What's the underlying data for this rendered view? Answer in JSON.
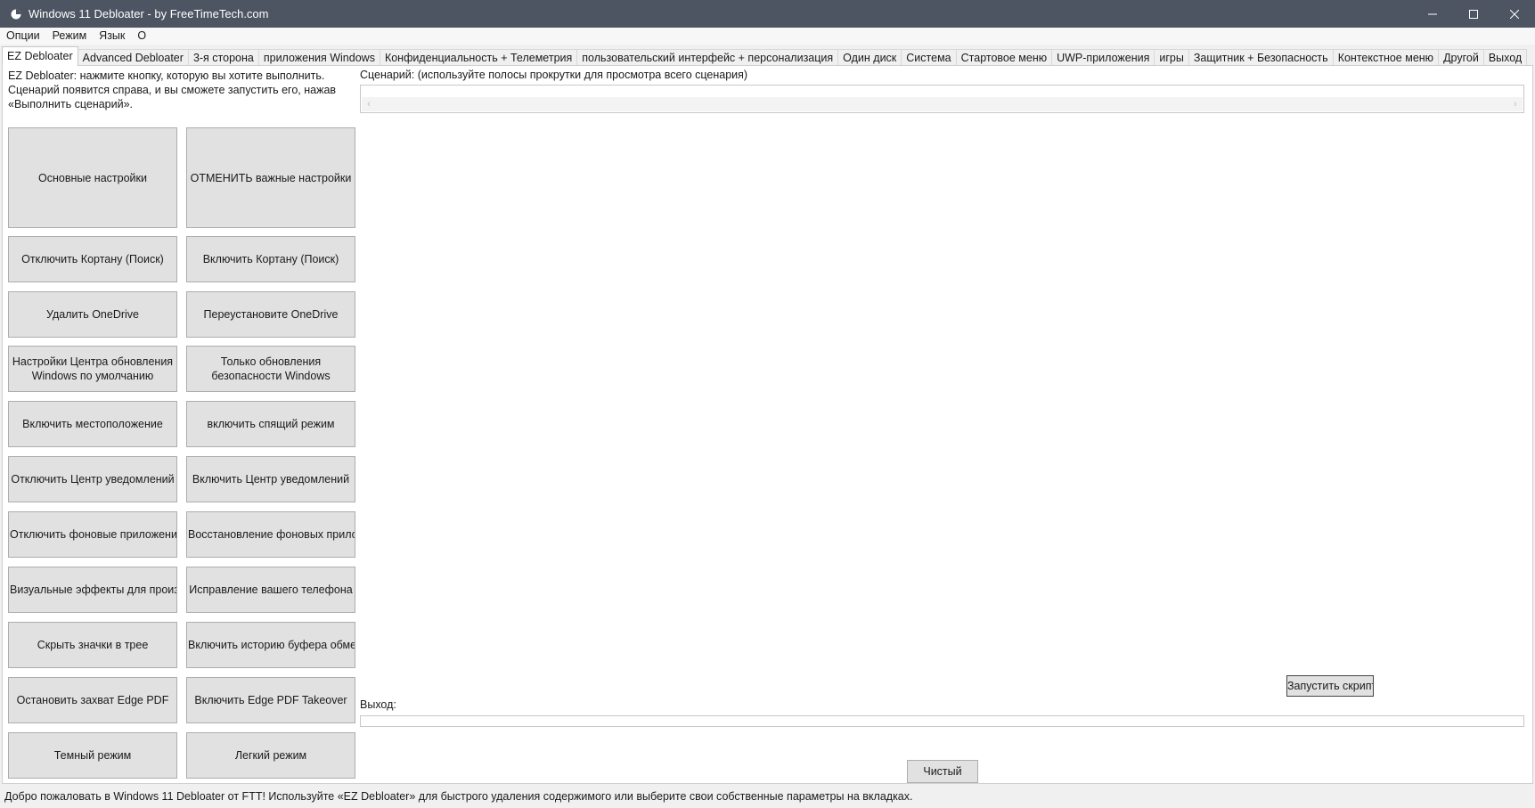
{
  "window": {
    "title": "Windows 11 Debloater - by FreeTimeTech.com"
  },
  "menu": [
    "Опции",
    "Режим",
    "Язык",
    "О"
  ],
  "tabs": [
    {
      "label": "EZ Debloater",
      "active": true
    },
    {
      "label": "Advanced Debloater"
    },
    {
      "label": "3-я сторона"
    },
    {
      "label": "приложения Windows"
    },
    {
      "label": "Конфиденциальность + Телеметрия"
    },
    {
      "label": "пользовательский интерфейс + персонализация"
    },
    {
      "label": "Один диск"
    },
    {
      "label": "Система"
    },
    {
      "label": "Стартовое меню"
    },
    {
      "label": "UWP-приложения"
    },
    {
      "label": "игры"
    },
    {
      "label": "Защитник + Безопасность"
    },
    {
      "label": "Контекстное меню"
    },
    {
      "label": "Другой"
    },
    {
      "label": "Выход"
    }
  ],
  "ez": {
    "intro": "EZ Debloater: нажмите кнопку, которую вы хотите выполнить.\nСценарий появится справа, и вы сможете запустить его, нажав\n«Выполнить сценарий».",
    "buttons": [
      [
        "Основные настройки",
        "ОТМЕНИТЬ важные настройки"
      ],
      [
        "Отключить Кортану (Поиск)",
        "Включить Кортану (Поиск)"
      ],
      [
        "Удалить OneDrive",
        "Переустановите OneDrive"
      ],
      [
        "Настройки Центра обновления\nWindows по умолчанию",
        "Только обновления\nбезопасности Windows"
      ],
      [
        "Включить местоположение",
        "включить спящий режим"
      ],
      [
        "Отключить Центр уведомлений",
        "Включить Центр уведомлений"
      ],
      [
        "Отключить фоновые приложения",
        "Восстановление фоновых прилож"
      ],
      [
        "Визуальные эффекты для произвс",
        "Исправление вашего телефона"
      ],
      [
        "Скрыть значки в трее",
        "Включить историю буфера обмен"
      ],
      [
        "Остановить захват Edge PDF",
        "Включить Edge PDF Takeover"
      ],
      [
        "Темный режим",
        "Легкий режим"
      ]
    ]
  },
  "script": {
    "label": "Сценарий: (используйте полосы прокрутки для просмотра всего сценария)",
    "run_label": "Запустить скрипт"
  },
  "output": {
    "label": "Выход:",
    "clear_label": "Чистый"
  },
  "status": "Добро пожаловать в Windows 11 Debloater от FTT! Используйте «EZ Debloater» для быстрого удаления содержимого или выберите свои собственные параметры на вкладках.",
  "colors": {
    "titlebar": "#4d5462",
    "button_face": "#e1e1e1",
    "button_border": "#adadad"
  }
}
